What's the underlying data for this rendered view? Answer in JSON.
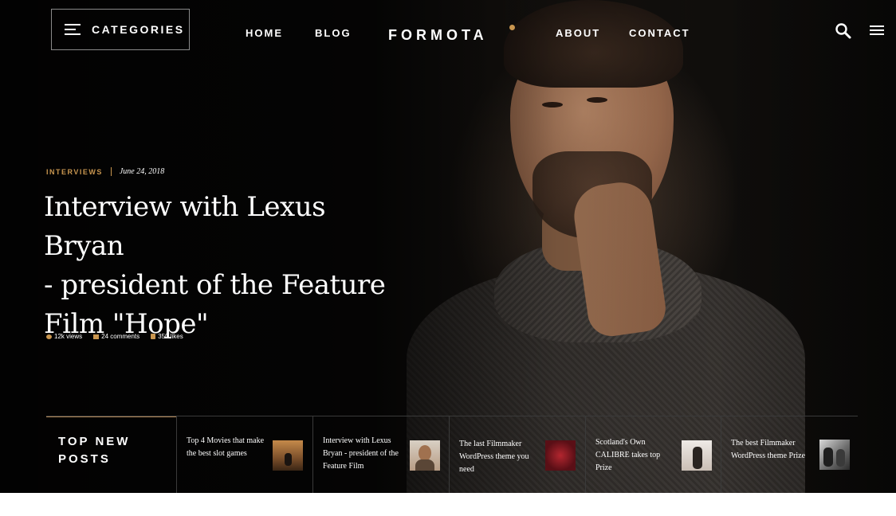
{
  "header": {
    "categories_label": "CATEGORIES",
    "nav": [
      "HOME",
      "BLOG",
      "ABOUT",
      "CONTACT"
    ],
    "logo": "FORMOTA",
    "icons": [
      "menu-icon",
      "search-icon",
      "hamburger-icon"
    ]
  },
  "article": {
    "category": "INTERVIEWS",
    "date": "June 24, 2018",
    "title": "Interview with Lexus Bryan - president of the Feature Film \"Hope\"",
    "title_lines": [
      "Interview with Lexus Bryan",
      "- president of the Feature",
      "Film \"Hope\""
    ],
    "stats": {
      "views": "12k views",
      "comments": "24 comments",
      "likes": "350 likes"
    }
  },
  "top_posts": {
    "label": "TOP NEW POSTS",
    "items": [
      {
        "title": "Top 4 Movies that make the best slot games"
      },
      {
        "title": "Interview with Lexus Bryan - president of the Feature Film"
      },
      {
        "title": "The last Filmmaker WordPress theme you need"
      },
      {
        "title": "Scotland's Own CALIBRE takes top Prize"
      },
      {
        "title": "The best Filmmaker WordPress theme Prize"
      }
    ]
  },
  "colors": {
    "accent": "#c9964f",
    "background": "#0d0c0b",
    "text": "#ffffff"
  }
}
